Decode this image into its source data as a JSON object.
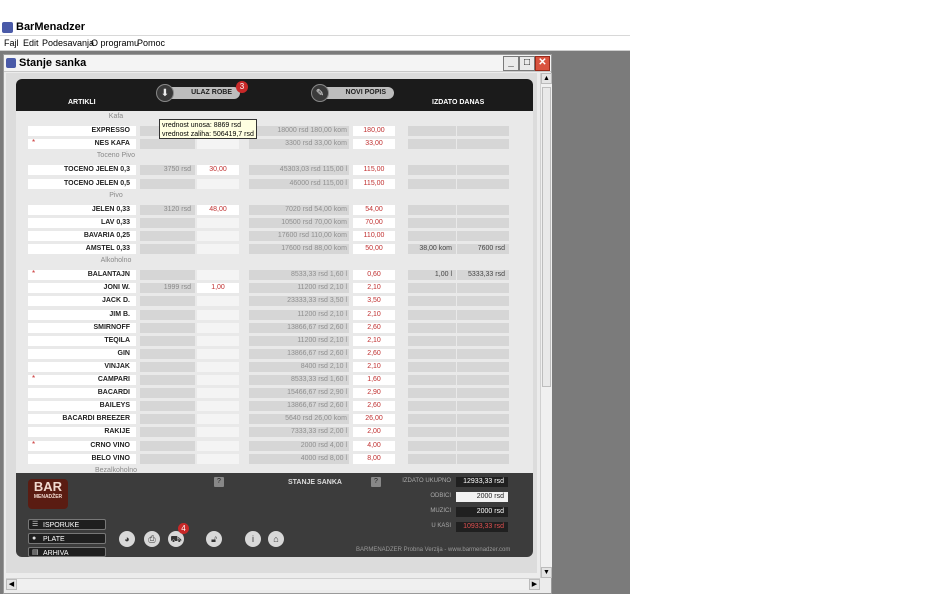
{
  "app": {
    "title": "BarMenadzer"
  },
  "menu": [
    "Fajl",
    "Edit",
    "Podesavanja",
    "O programu",
    "Pomoc"
  ],
  "window": {
    "title": "Stanje sanka",
    "min": "_",
    "max": "□",
    "close": "✕"
  },
  "header": {
    "artikli": "ARTIKLI",
    "ulaz_robe": "ULAZ ROBE",
    "ulaz_badge": "3",
    "novi_popis": "NOVI POPIS",
    "izdato_danas": "IZDATO DANAS"
  },
  "tooltip": {
    "line1": "vrednost unosa: 8869 rsd",
    "line2": "vrednost zaliha: 506419,7 rsd"
  },
  "sections": [
    {
      "label": "Kafa",
      "items": [
        {
          "name": "EXPRESSO",
          "star": false,
          "c1": "",
          "c2": "",
          "c3": "18000 rsd   180,00 kom",
          "c4": "180,00",
          "c5": "",
          "c6": ""
        },
        {
          "name": "NES KAFA",
          "star": true,
          "c1": "",
          "c2": "",
          "c3": "3300 rsd   33,00 kom",
          "c4": "33,00",
          "c5": "",
          "c6": ""
        }
      ]
    },
    {
      "label": "Toceno Pivo",
      "items": [
        {
          "name": "TOCENO JELEN 0,3",
          "star": false,
          "c1": "3750 rsd",
          "c2": "30,00",
          "c3": "45303,03 rsd   115,00  l",
          "c4": "115,00",
          "c5": "",
          "c6": ""
        },
        {
          "name": "TOCENO JELEN 0,5",
          "star": false,
          "c1": "",
          "c2": "",
          "c3": "46000 rsd   115,00  l",
          "c4": "115,00",
          "c5": "",
          "c6": ""
        }
      ]
    },
    {
      "label": "Pivo",
      "items": [
        {
          "name": "JELEN 0,33",
          "star": false,
          "c1": "3120 rsd",
          "c2": "48,00",
          "c3": "7020 rsd   54,00 kom",
          "c4": "54,00",
          "c5": "",
          "c6": ""
        },
        {
          "name": "LAV 0,33",
          "star": false,
          "c1": "",
          "c2": "",
          "c3": "10500 rsd   70,00 kom",
          "c4": "70,00",
          "c5": "",
          "c6": ""
        },
        {
          "name": "BAVARIA 0,25",
          "star": false,
          "c1": "",
          "c2": "",
          "c3": "17600 rsd   110,00 kom",
          "c4": "110,00",
          "c5": "",
          "c6": ""
        },
        {
          "name": "AMSTEL 0,33",
          "star": false,
          "c1": "",
          "c2": "",
          "c3": "17600 rsd   88,00 kom",
          "c4": "50,00",
          "c5": "38,00 kom",
          "c6": "7600 rsd"
        }
      ]
    },
    {
      "label": "Alkoholno",
      "items": [
        {
          "name": "BALANTAJN",
          "star": true,
          "c1": "",
          "c2": "",
          "c3": "8533,33 rsd   1,60  l",
          "c4": "0,60",
          "c5": "1,00  l",
          "c6": "5333,33 rsd"
        },
        {
          "name": "JONI W.",
          "star": false,
          "c1": "1999 rsd",
          "c2": "1,00",
          "c3": "11200 rsd   2,10  l",
          "c4": "2,10",
          "c5": "",
          "c6": ""
        },
        {
          "name": "JACK D.",
          "star": false,
          "c1": "",
          "c2": "",
          "c3": "23333,33 rsd   3,50  l",
          "c4": "3,50",
          "c5": "",
          "c6": ""
        },
        {
          "name": "JIM B.",
          "star": false,
          "c1": "",
          "c2": "",
          "c3": "11200 rsd   2,10  l",
          "c4": "2,10",
          "c5": "",
          "c6": ""
        },
        {
          "name": "SMIRNOFF",
          "star": false,
          "c1": "",
          "c2": "",
          "c3": "13866,67 rsd   2,60  l",
          "c4": "2,60",
          "c5": "",
          "c6": ""
        },
        {
          "name": "TEQILA",
          "star": false,
          "c1": "",
          "c2": "",
          "c3": "11200 rsd   2,10  l",
          "c4": "2,10",
          "c5": "",
          "c6": ""
        },
        {
          "name": "GIN",
          "star": false,
          "c1": "",
          "c2": "",
          "c3": "13866,67 rsd   2,60  l",
          "c4": "2,60",
          "c5": "",
          "c6": ""
        },
        {
          "name": "VINJAK",
          "star": false,
          "c1": "",
          "c2": "",
          "c3": "8400 rsd   2,10  l",
          "c4": "2,10",
          "c5": "",
          "c6": ""
        },
        {
          "name": "CAMPARI",
          "star": true,
          "c1": "",
          "c2": "",
          "c3": "8533,33 rsd   1,60  l",
          "c4": "1,60",
          "c5": "",
          "c6": ""
        },
        {
          "name": "BACARDI",
          "star": false,
          "c1": "",
          "c2": "",
          "c3": "15466,67 rsd   2,90  l",
          "c4": "2,90",
          "c5": "",
          "c6": ""
        },
        {
          "name": "BAILEYS",
          "star": false,
          "c1": "",
          "c2": "",
          "c3": "13866,67 rsd   2,60  l",
          "c4": "2,60",
          "c5": "",
          "c6": ""
        },
        {
          "name": "BACARDI BREEZER",
          "star": false,
          "c1": "",
          "c2": "",
          "c3": "5640 rsd   26,00 kom",
          "c4": "26,00",
          "c5": "",
          "c6": ""
        },
        {
          "name": "RAKIJE",
          "star": false,
          "c1": "",
          "c2": "",
          "c3": "7333,33 rsd   2,00  l",
          "c4": "2,00",
          "c5": "",
          "c6": ""
        },
        {
          "name": "CRNO VINO",
          "star": true,
          "c1": "",
          "c2": "",
          "c3": "2000 rsd   4,00  l",
          "c4": "4,00",
          "c5": "",
          "c6": ""
        },
        {
          "name": "BELO VINO",
          "star": false,
          "c1": "",
          "c2": "",
          "c3": "4000 rsd   8,00  l",
          "c4": "8,00",
          "c5": "",
          "c6": ""
        }
      ]
    },
    {
      "label": "Bezalkoholno",
      "items": []
    }
  ],
  "footer": {
    "logo_top": "BAR",
    "logo_sub": "MENADŽER",
    "stanje_sanka": "STANJE SANKA",
    "help": "?",
    "nav": [
      {
        "label": "ISPORUKE",
        "icon": "☰"
      },
      {
        "label": "PLATE",
        "icon": "●"
      },
      {
        "label": "ARHIVA",
        "icon": "▤"
      }
    ],
    "cart_badge": "4",
    "summary": [
      {
        "label": "IZDATO UKUPNO",
        "value": "12933,33 rsd"
      },
      {
        "label": "ODBICI",
        "value": "2000 rsd"
      },
      {
        "label": "MUZICI",
        "value": "2000 rsd"
      },
      {
        "label": "U KASI",
        "value": "10933,33 rsd"
      }
    ],
    "credit": "BARMENADZER Probna Verzija - www.barmenadzer.com"
  }
}
